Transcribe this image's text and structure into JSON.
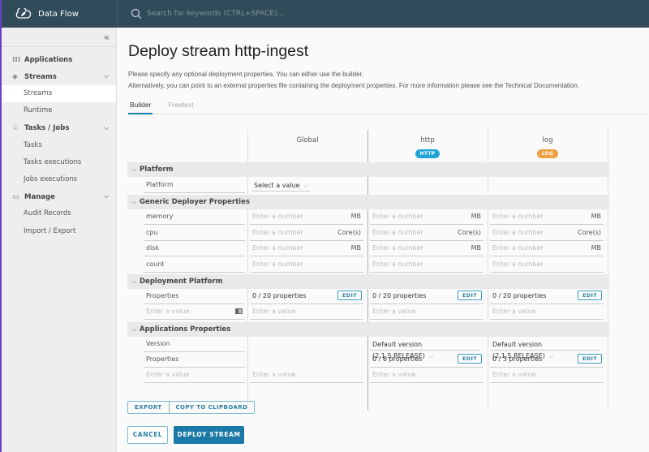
{
  "app": {
    "title": "Data Flow",
    "search_placeholder": "Search for keywords (CTRL+SPACE)...",
    "collapse_icon": "«"
  },
  "colors": {
    "topbar": "#314b5a",
    "accent": "#1a79a6",
    "http_badge": "#1ea5d8",
    "log_badge": "#f0a040",
    "window_edge": "#6b3fc4"
  },
  "sidebar": {
    "groups": [
      {
        "label": "Applications",
        "icon": "grid-icon",
        "items": []
      },
      {
        "label": "Streams",
        "icon": "streams-icon",
        "items": [
          "Streams",
          "Runtime"
        ]
      },
      {
        "label": "Tasks / Jobs",
        "icon": "tasks-icon",
        "items": [
          "Tasks",
          "Tasks executions",
          "Jobs executions"
        ]
      },
      {
        "label": "Manage",
        "icon": "briefcase-icon",
        "items": [
          "Audit Records",
          "Import / Export"
        ]
      }
    ],
    "active_item": "Streams"
  },
  "page": {
    "title": "Deploy stream http-ingest",
    "desc1": "Please specify any optional deployment properties. You can either use the builder.",
    "desc2": "Alternatively, you can point to an external properties file containing the deployment properties. For more information please see the Technical Documentation.",
    "tabs": [
      "Builder",
      "Freetext"
    ],
    "active_tab": "Builder"
  },
  "builder": {
    "columns": [
      {
        "title": "Global"
      },
      {
        "title": "http",
        "badge": "HTTP"
      },
      {
        "title": "log",
        "badge": "LOG"
      }
    ],
    "sections": {
      "platform": "Platform",
      "generic": "Generic Deployer Properties",
      "deployment": "Deployment Platform",
      "apps": "Applications Properties"
    },
    "platform_label": "Platform",
    "platform_select": "Select a value",
    "generic_rows": [
      {
        "label": "memory",
        "unit": "MB"
      },
      {
        "label": "cpu",
        "unit": "Core(s)"
      },
      {
        "label": "disk",
        "unit": "MB"
      },
      {
        "label": "count",
        "unit": ""
      }
    ],
    "number_placeholder": "Enter a number",
    "value_placeholder": "Enter a value",
    "properties_label": "Properties",
    "version_label": "Version",
    "deploy_props": [
      "0 / 20 properties",
      "0 / 20 properties",
      "0 / 20 properties"
    ],
    "app_versions": [
      "Default version (2.1.5.RELEASE)",
      "Default version (2.1.5.RELEASE)"
    ],
    "app_props": [
      "0 / 6 properties",
      "0 / 3 properties"
    ],
    "edit": "EDIT"
  },
  "actions": {
    "export": "EXPORT",
    "copy": "COPY TO CLIPBOARD",
    "cancel": "CANCEL",
    "deploy": "DEPLOY STREAM"
  }
}
